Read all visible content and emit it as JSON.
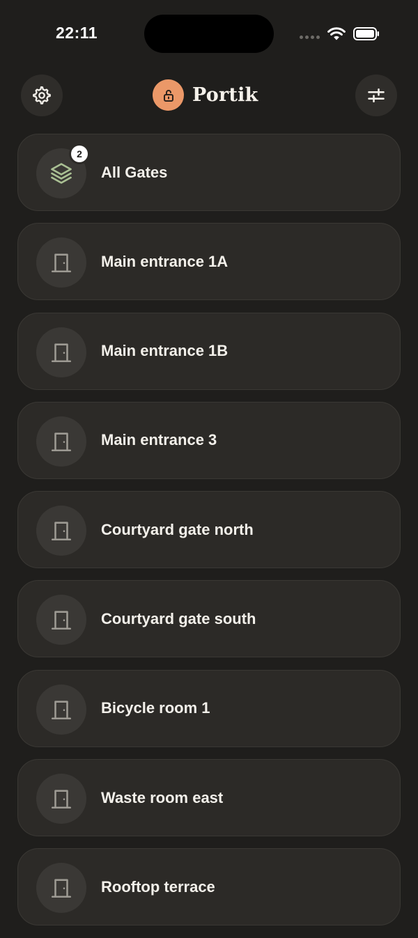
{
  "status_bar": {
    "time": "22:11"
  },
  "header": {
    "app_name": "Portik"
  },
  "icons": {
    "settings": "gear-icon",
    "filter": "sliders-icon",
    "logo": "unlock-icon",
    "all_gates": "layers-icon",
    "gate": "door-icon"
  },
  "colors": {
    "background": "#1f1e1c",
    "card": "#2c2a27",
    "accent_orange": "#eb9868",
    "layers_green": "#a9bf93",
    "door_gray": "#9d9a93"
  },
  "gates": [
    {
      "label": "All Gates",
      "badge": "2"
    },
    {
      "label": "Main entrance 1A"
    },
    {
      "label": "Main entrance 1B"
    },
    {
      "label": "Main entrance 3"
    },
    {
      "label": "Courtyard gate north"
    },
    {
      "label": "Courtyard gate south"
    },
    {
      "label": "Bicycle room 1"
    },
    {
      "label": "Waste room east"
    },
    {
      "label": "Rooftop terrace"
    }
  ]
}
